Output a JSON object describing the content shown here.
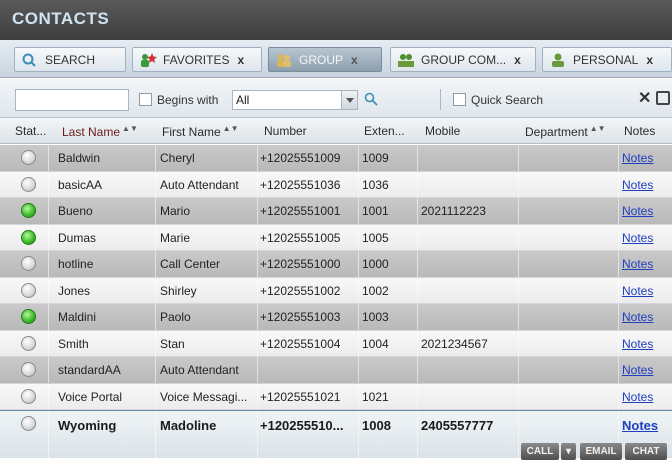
{
  "app": {
    "title": "CONTACTS"
  },
  "tabs": [
    {
      "label": "SEARCH",
      "icon": "search-icon",
      "closable": false,
      "active": false
    },
    {
      "label": "FAVORITES",
      "icon": "favorites-icon",
      "closable": true,
      "active": false
    },
    {
      "label": "GROUP",
      "icon": "group-icon",
      "closable": true,
      "active": true
    },
    {
      "label": "GROUP COM...",
      "icon": "group-common-icon",
      "closable": true,
      "active": false
    },
    {
      "label": "PERSONAL",
      "icon": "personal-icon",
      "closable": true,
      "active": false
    }
  ],
  "toolbar": {
    "search_value": "",
    "begins_with_label": "Begins with",
    "filter_value": "All",
    "quick_search_label": "Quick Search",
    "clear_symbol": "✕"
  },
  "columns": {
    "status": "Stat...",
    "last_name": "Last Name",
    "first_name": "First Name",
    "number": "Number",
    "extension": "Exten...",
    "mobile": "Mobile",
    "department": "Department",
    "notes": "Notes"
  },
  "rows": [
    {
      "status": "offline",
      "last": "Baldwin",
      "first": "Cheryl",
      "number": "+12025551009",
      "ext": "1009",
      "mobile": "",
      "dept": "",
      "notes": "Notes"
    },
    {
      "status": "offline",
      "last": "basicAA",
      "first": "Auto Attendant",
      "number": "+12025551036",
      "ext": "1036",
      "mobile": "",
      "dept": "",
      "notes": "Notes"
    },
    {
      "status": "available",
      "last": "Bueno",
      "first": "Mario",
      "number": "+12025551001",
      "ext": "1001",
      "mobile": "2021112223",
      "dept": "",
      "notes": "Notes"
    },
    {
      "status": "available",
      "last": "Dumas",
      "first": "Marie",
      "number": "+12025551005",
      "ext": "1005",
      "mobile": "",
      "dept": "",
      "notes": "Notes"
    },
    {
      "status": "offline",
      "last": "hotline",
      "first": "Call Center",
      "number": "+12025551000",
      "ext": "1000",
      "mobile": "",
      "dept": "",
      "notes": "Notes"
    },
    {
      "status": "offline",
      "last": "Jones",
      "first": "Shirley",
      "number": "+12025551002",
      "ext": "1002",
      "mobile": "",
      "dept": "",
      "notes": "Notes"
    },
    {
      "status": "available",
      "last": "Maldini",
      "first": "Paolo",
      "number": "+12025551003",
      "ext": "1003",
      "mobile": "",
      "dept": "",
      "notes": "Notes"
    },
    {
      "status": "offline",
      "last": "Smith",
      "first": "Stan",
      "number": "+12025551004",
      "ext": "1004",
      "mobile": "2021234567",
      "dept": "",
      "notes": "Notes"
    },
    {
      "status": "offline",
      "last": "standardAA",
      "first": "Auto Attendant",
      "number": "",
      "ext": "",
      "mobile": "",
      "dept": "",
      "notes": "Notes"
    },
    {
      "status": "offline",
      "last": "Voice Portal",
      "first": "Voice Messagi...",
      "number": "+12025551021",
      "ext": "1021",
      "mobile": "",
      "dept": "",
      "notes": "Notes"
    }
  ],
  "selected_row": {
    "status": "offline",
    "last": "Wyoming",
    "first": "Madoline",
    "number": "+120255510...",
    "ext": "1008",
    "mobile": "2405557777",
    "dept": "",
    "notes": "Notes"
  },
  "actions": {
    "call": "CALL",
    "email": "EMAIL",
    "chat": "CHAT"
  },
  "colors": {
    "available": "#3fbf2a",
    "link": "#1f3fbf",
    "titlebar": "#4a4a4a"
  }
}
